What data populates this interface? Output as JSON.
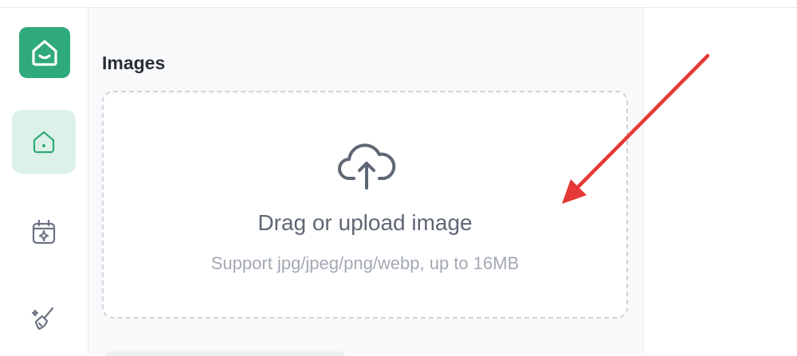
{
  "sidebar": {
    "logo_icon": "house-smile-icon",
    "items": [
      {
        "id": "home",
        "icon": "home-icon",
        "active": true
      },
      {
        "id": "calendar",
        "icon": "calendar-sparkle-icon",
        "active": false
      },
      {
        "id": "clean",
        "icon": "broom-icon",
        "active": false
      }
    ]
  },
  "panel": {
    "title": "Images",
    "dropzone": {
      "icon": "cloud-upload-icon",
      "title": "Drag or upload image",
      "hint": "Support jpg/jpeg/png/webp, up to 16MB"
    }
  },
  "colors": {
    "brand": "#2eaa7b",
    "active_bg": "#dcf1e8",
    "annotation": "#e53935"
  }
}
